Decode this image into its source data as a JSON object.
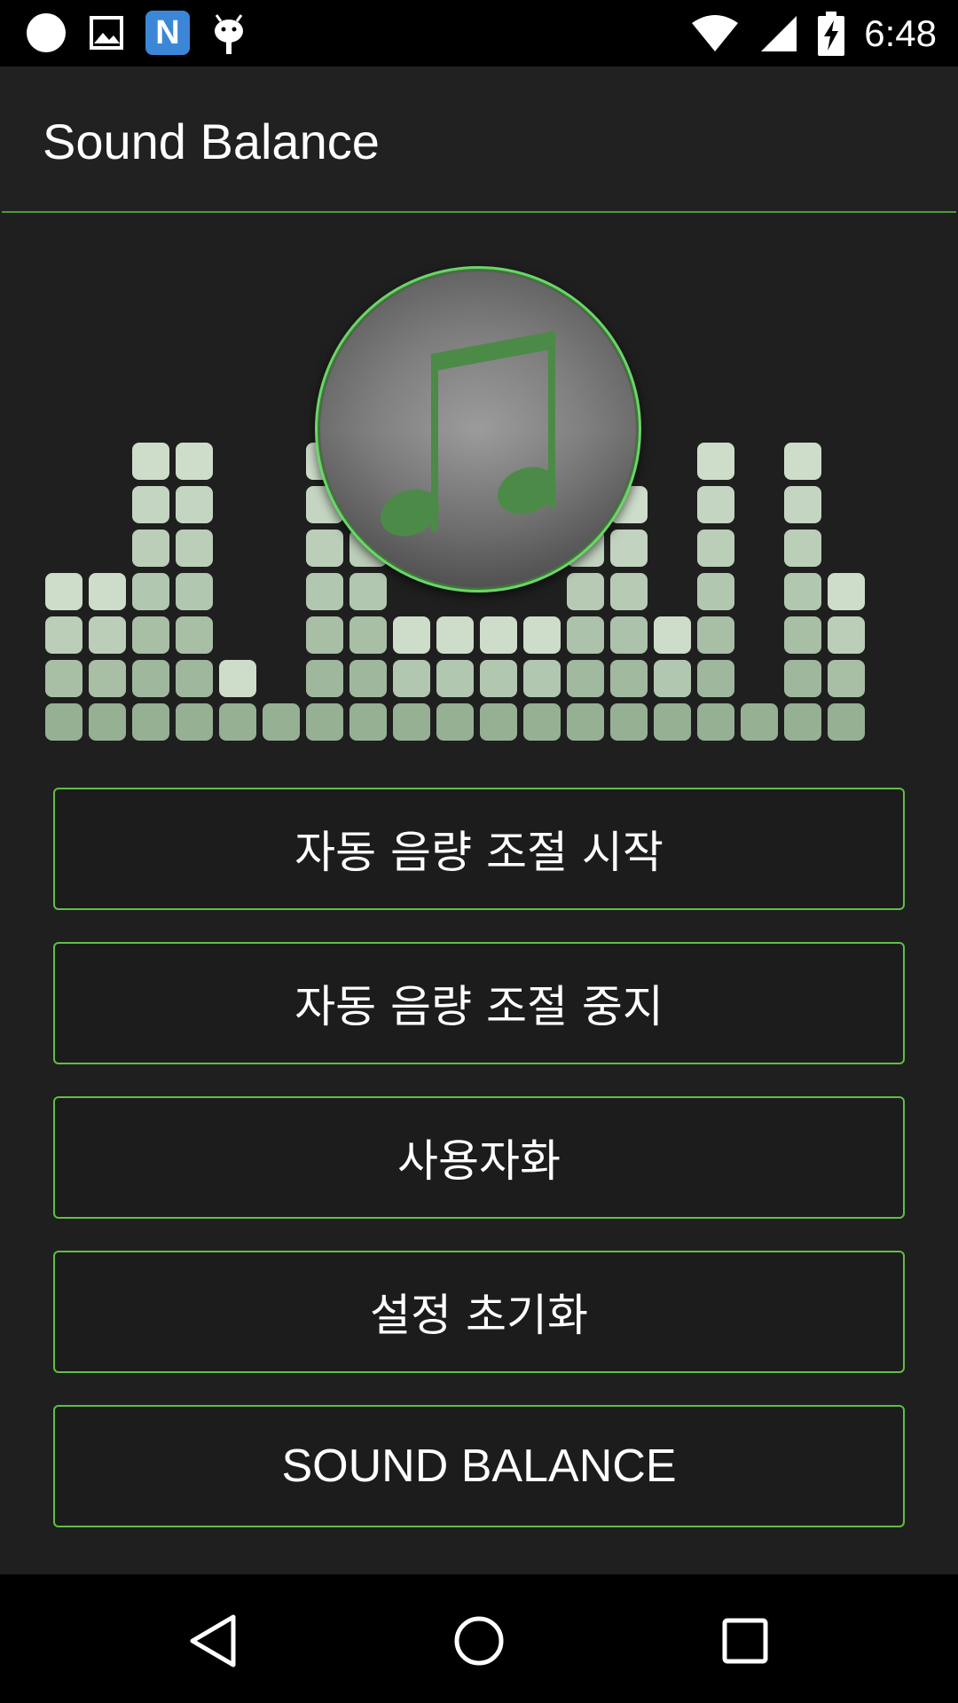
{
  "status_bar": {
    "time": "6:48",
    "left_icons": [
      "circle-icon",
      "image-icon",
      "n-app-icon",
      "android-icon"
    ],
    "n_label": "N",
    "right_icons": [
      "wifi-icon",
      "signal-icon",
      "battery-charging-icon"
    ]
  },
  "app_bar": {
    "title": "Sound Balance"
  },
  "equalizer": {
    "columns": [
      4,
      4,
      7,
      7,
      2,
      1,
      7,
      7,
      3,
      3,
      3,
      3,
      6,
      6,
      3,
      7,
      1,
      7,
      4
    ],
    "block_color": "#9db59a",
    "top_block_color": "#c9dbc6"
  },
  "center_disc": {
    "icon": "music-note-icon",
    "ring_color": "#6bd56a",
    "note_color": "#4c8a48"
  },
  "buttons": [
    {
      "label": "자동 음량 조절 시작"
    },
    {
      "label": "자동 음량 조절 중지"
    },
    {
      "label": "사용자화"
    },
    {
      "label": "설정 초기화"
    },
    {
      "label": "SOUND BALANCE"
    }
  ],
  "colors": {
    "accent": "#5fbf45",
    "background": "#1f1f1f",
    "app_bar": "#212121"
  },
  "nav_bar": {
    "icons": [
      "back-icon",
      "home-icon",
      "recents-icon"
    ]
  }
}
